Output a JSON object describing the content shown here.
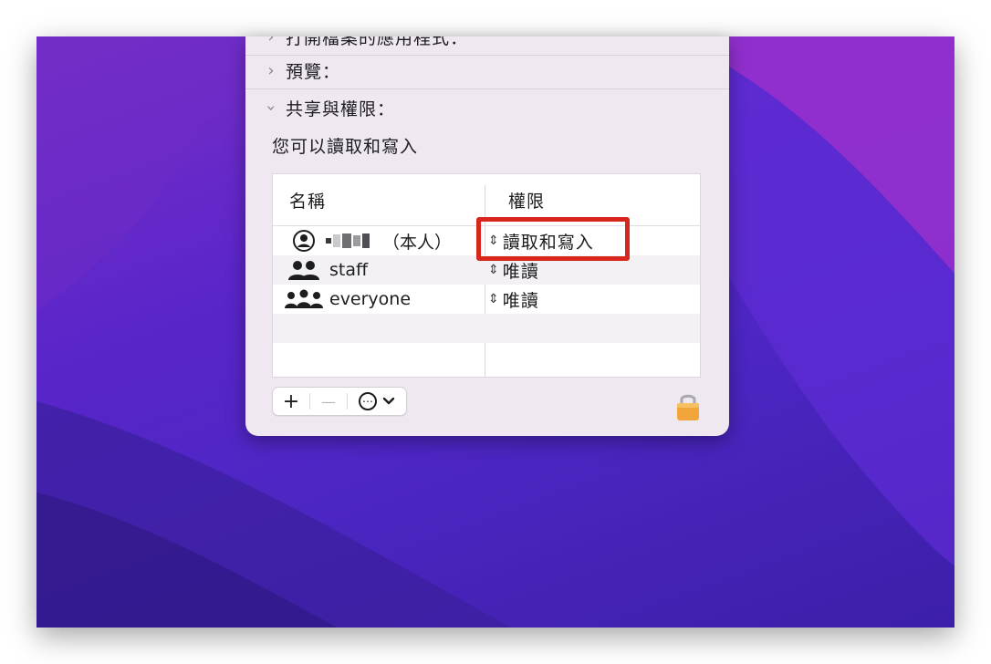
{
  "sections": [
    {
      "label": "打開檔案的應用程式：",
      "expanded": false
    },
    {
      "label": "預覽：",
      "expanded": false
    },
    {
      "label": "共享與權限：",
      "expanded": true
    }
  ],
  "sharing": {
    "summary": "您可以讀取和寫入",
    "columns": {
      "name": "名稱",
      "permission": "權限"
    },
    "rows": [
      {
        "icon": "person-circle-icon",
        "name": "（本人）",
        "permission": "讀取和寫入"
      },
      {
        "icon": "two-people-icon",
        "name": "staff",
        "permission": "唯讀"
      },
      {
        "icon": "group-people-icon",
        "name": "everyone",
        "permission": "唯讀"
      }
    ]
  },
  "toolbar": {
    "add": "+",
    "remove": "—",
    "more": "⋯"
  },
  "colors": {
    "highlight": "#d8261c",
    "panel": "#efe8f1",
    "desktop": "#5a25c9"
  }
}
